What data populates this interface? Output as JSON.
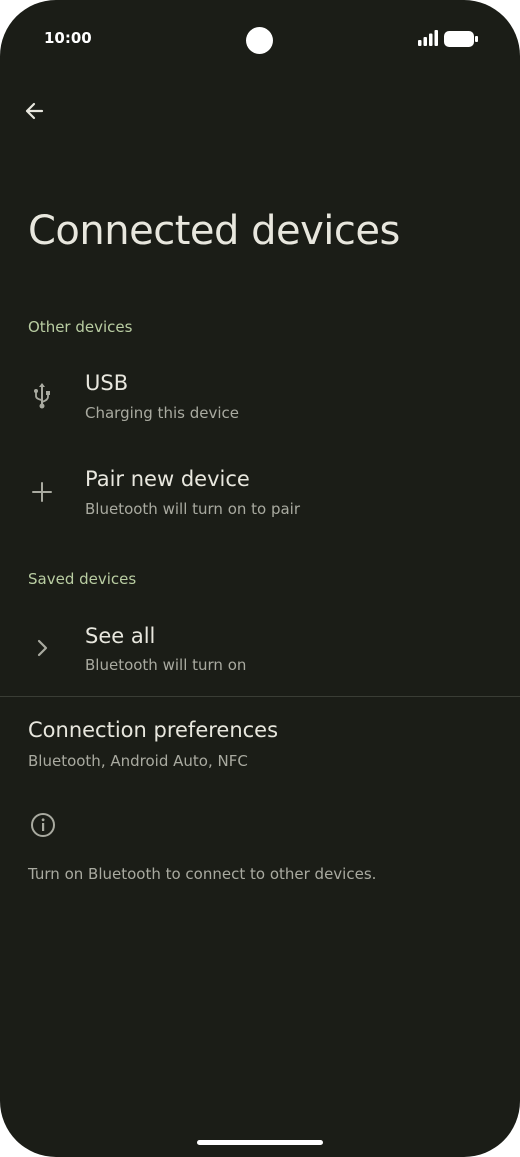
{
  "status_bar": {
    "time": "10:00",
    "icons": [
      "camera-cutout",
      "signal-icon",
      "battery-icon"
    ]
  },
  "toolbar": {
    "back_icon": "arrow-left-icon"
  },
  "page": {
    "title": "Connected devices"
  },
  "other_devices": {
    "header": "Other devices",
    "items": [
      {
        "title": "USB",
        "subtitle": "Charging this device",
        "icon": "usb-icon"
      },
      {
        "title": "Pair new device",
        "subtitle": "Bluetooth will turn on to pair",
        "icon": "plus-icon"
      }
    ]
  },
  "saved_devices": {
    "header": "Saved devices",
    "items": [
      {
        "title": "See all",
        "subtitle": "Bluetooth will turn on",
        "icon": "chevron-right-icon"
      }
    ]
  },
  "connection_preferences": {
    "title": "Connection preferences",
    "subtitle": "Bluetooth, Android Auto, NFC"
  },
  "footer": {
    "icon": "info-icon",
    "text": "Turn on Bluetooth to connect to other devices."
  },
  "colors": {
    "background": "#1b1d17",
    "section_header": "#b9cda2",
    "primary_text": "#e8e7de",
    "secondary_text": "#a9aaa0"
  }
}
